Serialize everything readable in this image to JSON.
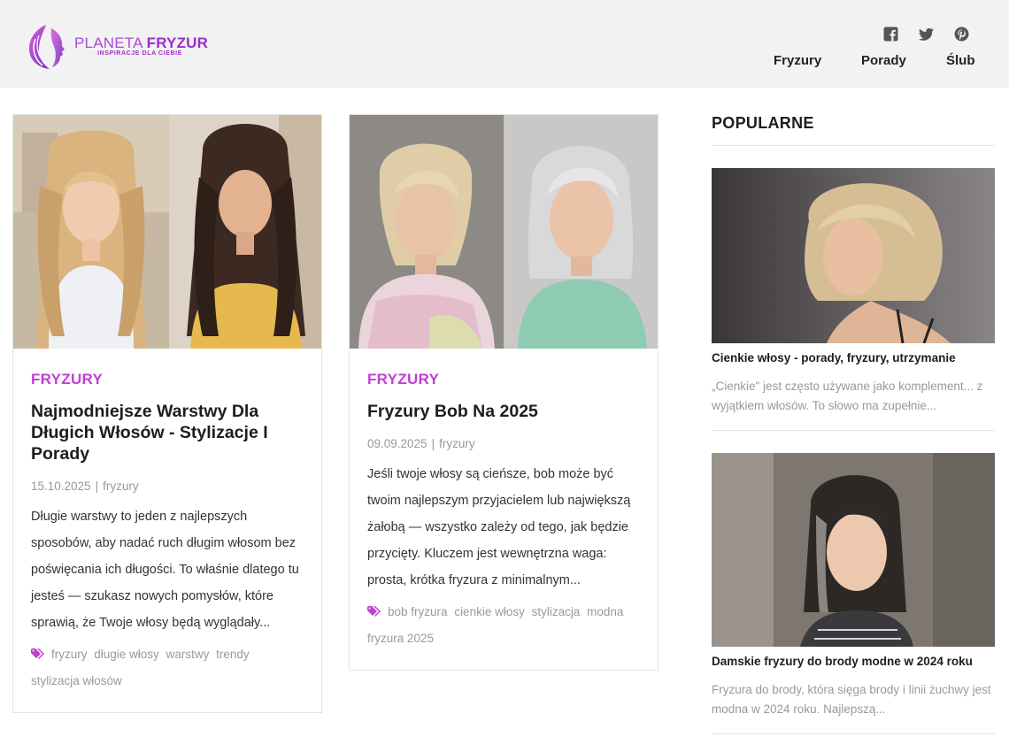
{
  "header": {
    "logo": {
      "name_light": "PLANETA ",
      "name_bold": "FRYZUR",
      "tagline": "INSPIRACJE DLA CIEBIE"
    },
    "social_icons": [
      "facebook-icon",
      "twitter-icon",
      "pinterest-icon"
    ],
    "nav": [
      "Fryzury",
      "Porady",
      "Ślub"
    ]
  },
  "posts": [
    {
      "category": "FRYZURY",
      "title": "Najmodniejsze Warstwy Dla Długich Włosów - Stylizacje I Porady",
      "date": "15.10.2025",
      "author": "fryzury",
      "excerpt": "Długie warstwy to jeden z najlepszych sposobów, aby nadać ruch długim włosom bez poświęcania ich długości. To właśnie dlatego tu jesteś — szukasz nowych pomysłów, które sprawią, że Twoje włosy będą wyglądały...",
      "tags": [
        "fryzury",
        "długie włosy",
        "warstwy",
        "trendy",
        "stylizacja włosów"
      ]
    },
    {
      "category": "FRYZURY",
      "title": "Fryzury Bob Na 2025",
      "date": "09.09.2025",
      "author": "fryzury",
      "excerpt": "Jeśli twoje włosy są cieńsze, bob może być twoim najlepszym przyjacielem lub największą żałobą — wszystko zależy od tego, jak będzie przycięty. Kluczem jest wewnętrzna waga: prosta, krótka fryzura z minimalnym...",
      "tags": [
        "bob fryzura",
        "cienkie włosy",
        "stylizacja",
        "modna fryzura 2025"
      ]
    }
  ],
  "sidebar": {
    "title": "POPULARNE",
    "items": [
      {
        "title": "Cienkie włosy - porady, fryzury, utrzymanie",
        "excerpt": "„Cienkie\" jest często używane jako komplement... z wyjątkiem włosów. To słowo ma zupełnie..."
      },
      {
        "title": "Damskie fryzury do brody modne w 2024 roku",
        "excerpt": "Fryzura do brody, która sięga brody i linii żuchwy jest modna w 2024 roku. Najlepszą..."
      }
    ]
  },
  "colors": {
    "accent": "#c03fd3",
    "logo": "#9b2fc8",
    "header_bg": "#f2f2f2"
  }
}
